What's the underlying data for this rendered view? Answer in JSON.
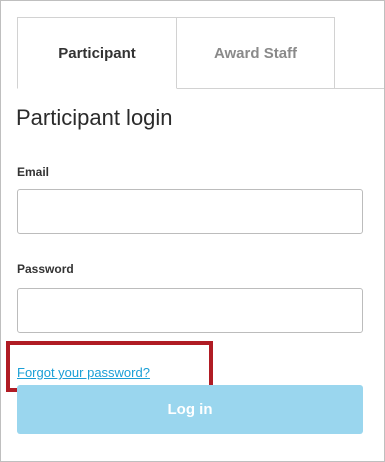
{
  "tabs": [
    {
      "label": "Participant",
      "active": true
    },
    {
      "label": "Award Staff",
      "active": false
    }
  ],
  "login": {
    "title": "Participant login",
    "email_label": "Email",
    "email_value": "",
    "password_label": "Password",
    "password_value": "",
    "forgot_link": "Forgot your password?",
    "submit_label": "Log in"
  },
  "colors": {
    "link": "#1a9fd6",
    "button": "#9ad6ee",
    "highlight": "#b01c24"
  }
}
